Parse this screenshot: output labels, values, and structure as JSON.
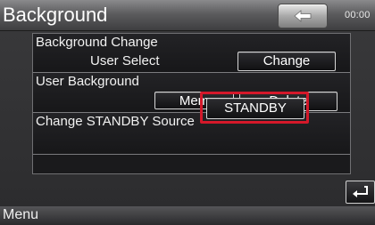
{
  "header": {
    "title": "Background",
    "clock": "00:00",
    "back_icon": "back-arrow-icon"
  },
  "rows": [
    {
      "label": "Background Change",
      "value": "User Select",
      "buttons": [
        "Change"
      ]
    },
    {
      "label": "User Background",
      "buttons": [
        "Memory",
        "Delete"
      ]
    },
    {
      "label": "Change STANDBY Source",
      "buttons": [
        "STANDBY"
      ]
    }
  ],
  "footer": {
    "menu_label": "Menu",
    "return_icon": "return-icon"
  },
  "colors": {
    "highlight": "#d4182a"
  }
}
